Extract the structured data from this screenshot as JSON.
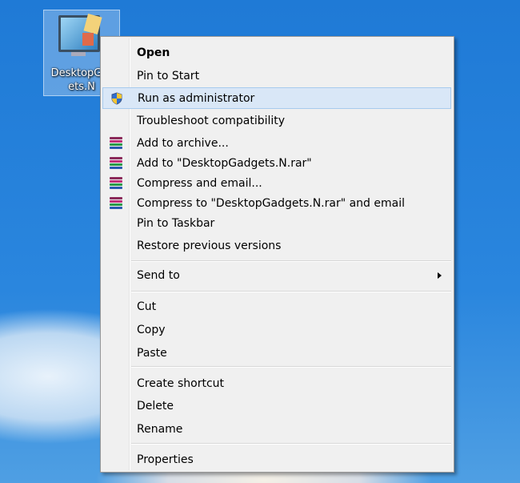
{
  "desktop_icon": {
    "label": "DesktopGadgets.N",
    "label_display": "DesktopG…\nets.N"
  },
  "menu": {
    "items": [
      {
        "label": "Open",
        "icon": null
      },
      {
        "label": "Pin to Start",
        "icon": null
      },
      {
        "label": "Run as administrator",
        "icon": "uac-shield-icon"
      },
      {
        "label": "Troubleshoot compatibility",
        "icon": null
      },
      {
        "label": "Add to archive...",
        "icon": "winrar-icon"
      },
      {
        "label": "Add to \"DesktopGadgets.N.rar\"",
        "icon": "winrar-icon"
      },
      {
        "label": "Compress and email...",
        "icon": "winrar-icon"
      },
      {
        "label": "Compress to \"DesktopGadgets.N.rar\" and email",
        "icon": "winrar-icon"
      },
      {
        "label": "Pin to Taskbar",
        "icon": null
      },
      {
        "label": "Restore previous versions",
        "icon": null
      },
      {
        "label": "Send to",
        "icon": null,
        "submenu": true
      },
      {
        "label": "Cut",
        "icon": null
      },
      {
        "label": "Copy",
        "icon": null
      },
      {
        "label": "Paste",
        "icon": null
      },
      {
        "label": "Create shortcut",
        "icon": null
      },
      {
        "label": "Delete",
        "icon": null
      },
      {
        "label": "Rename",
        "icon": null
      },
      {
        "label": "Properties",
        "icon": null
      }
    ]
  }
}
